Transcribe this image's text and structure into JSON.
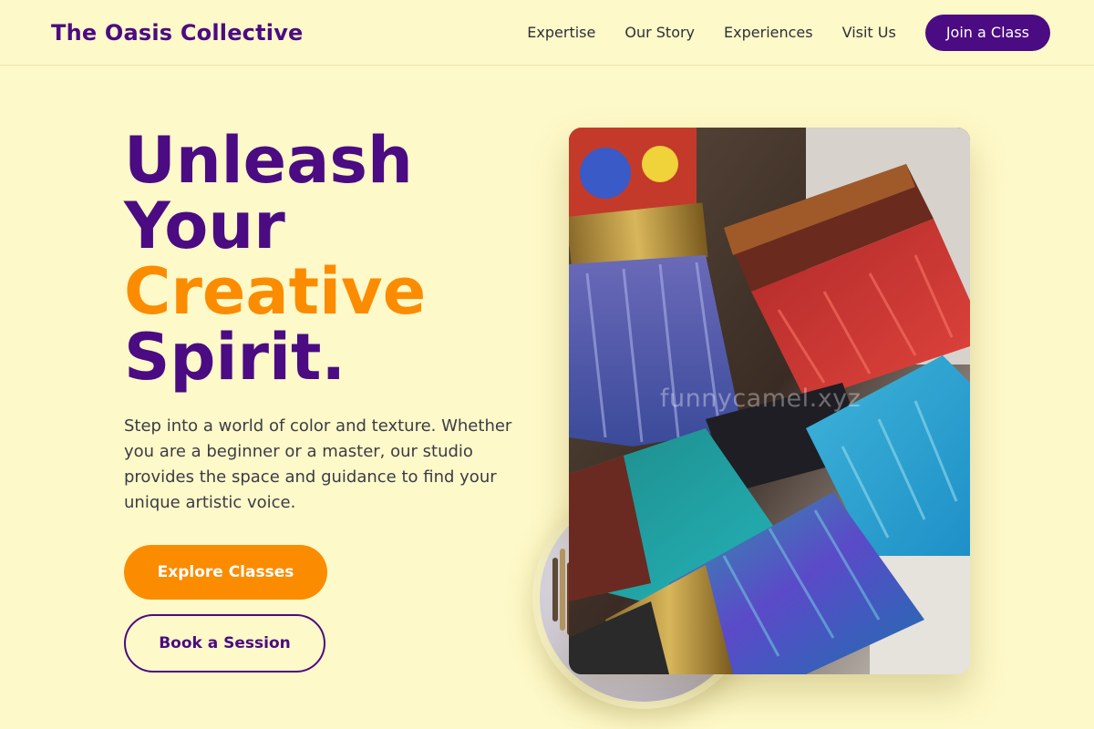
{
  "header": {
    "brand": "The Oasis Collective",
    "nav": [
      "Expertise",
      "Our Story",
      "Experiences",
      "Visit Us"
    ],
    "cta": "Join a Class"
  },
  "hero": {
    "headline": [
      "Unleash",
      "Your",
      "Creative",
      "Spirit."
    ],
    "lead": "Step into a world of color and texture. Whether you are a beginner or a master, our studio provides the space and guidance to find your unique artistic voice.",
    "primary_cta": "Explore Classes",
    "secondary_cta": "Book a Session"
  },
  "image": {
    "subject": "paint-brushes-photo",
    "watermark": "funnycamel.xyz"
  },
  "colors": {
    "background": "#fef9c8",
    "brand_purple": "#4b0b82",
    "accent_orange": "#fb8c00"
  }
}
